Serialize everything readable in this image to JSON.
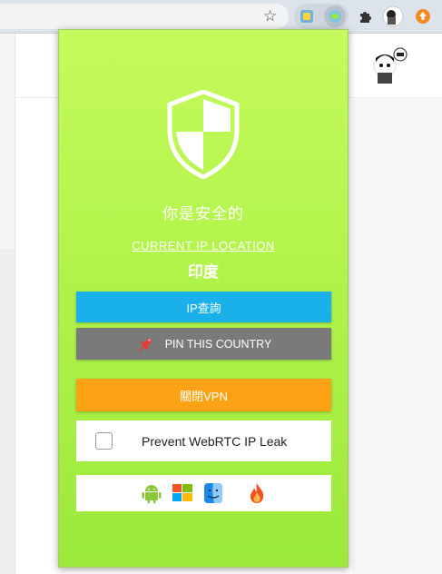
{
  "browser": {
    "bookmark_icon": "star-icon",
    "extensions": [
      "extension-icon",
      "vpn-extension-icon",
      "puzzle-icon",
      "profile-avatar-icon",
      "update-icon"
    ]
  },
  "popup": {
    "status_text": "你是安全的",
    "location_link": "CURRENT IP LOCATION",
    "country": "印度",
    "ip_lookup_button": "IP查詢",
    "pin_button": "PIN THIS COUNTRY",
    "disconnect_button": "關閉VPN",
    "webrtc_label": "Prevent WebRTC IP Leak",
    "webrtc_checked": false,
    "platforms": [
      "android-icon",
      "windows-icon",
      "mac-finder-icon",
      "fire-icon"
    ]
  },
  "colors": {
    "popup_top": "#c5fa5c",
    "popup_bottom": "#9be93a",
    "ip_button": "#1ab0ea",
    "pin_button": "#7a7a7a",
    "vpn_button": "#fca315"
  }
}
